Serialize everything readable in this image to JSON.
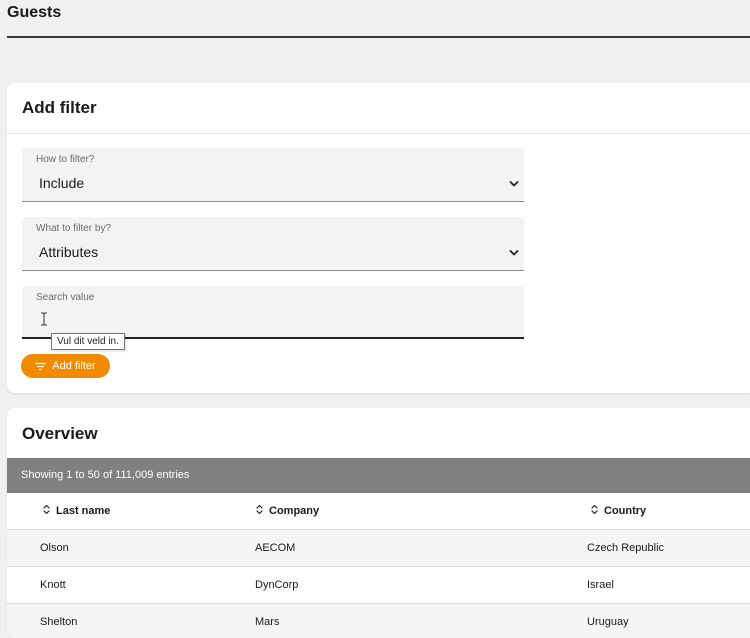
{
  "page": {
    "title": "Guests"
  },
  "filter": {
    "title": "Add filter",
    "how_to_filter": {
      "label": "How to filter?",
      "value": "Include",
      "icon": "chevron-down-icon"
    },
    "what_to_filter": {
      "label": "What to filter by?",
      "value": "Attributes",
      "icon": "chevron-down-icon"
    },
    "search": {
      "label": "Search value",
      "value": "",
      "tooltip": "Vul dit veld in."
    },
    "add_button": {
      "label": "Add filter",
      "icon": "filter-icon"
    }
  },
  "overview": {
    "title": "Overview",
    "info": "Showing 1 to 50 of 111,009 entries",
    "columns": [
      {
        "label": "Last name",
        "icon": "sort-icon"
      },
      {
        "label": "Company",
        "icon": "sort-icon"
      },
      {
        "label": "Country",
        "icon": "sort-icon"
      }
    ],
    "rows": [
      {
        "last_name": "Olson",
        "company": "AECOM",
        "country": "Czech Republic"
      },
      {
        "last_name": "Knott",
        "company": "DynCorp",
        "country": "Israel"
      },
      {
        "last_name": "Shelton",
        "company": "Mars",
        "country": "Uruguay"
      }
    ]
  },
  "colors": {
    "accent": "#f28a00",
    "info_bar": "#808080",
    "page_background": "#f0f0f0"
  }
}
